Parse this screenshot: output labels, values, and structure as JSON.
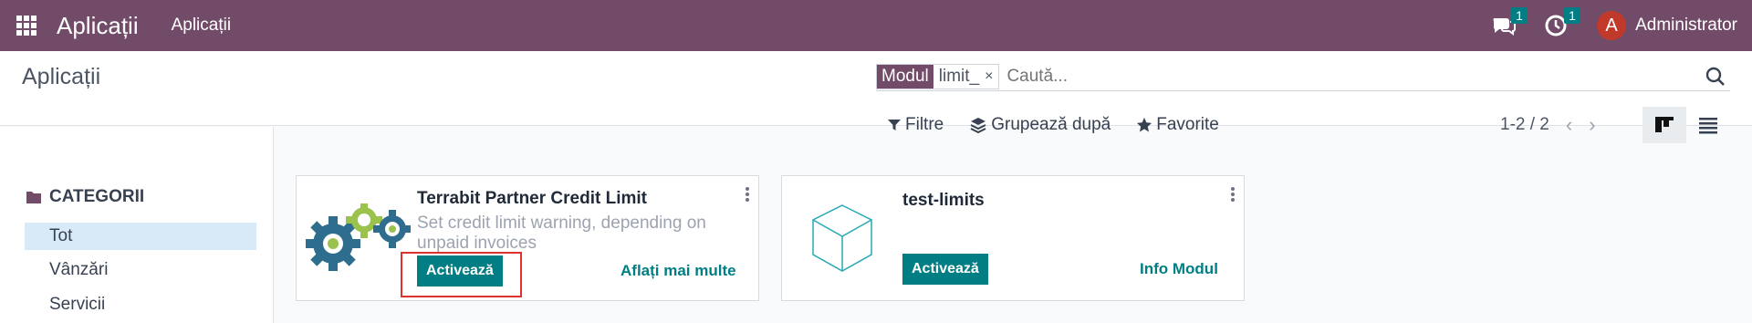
{
  "navbar": {
    "brand": "Aplicații",
    "menu": "Aplicații",
    "messages_count": "1",
    "activities_count": "1",
    "avatar_letter": "A",
    "user": "Administrator"
  },
  "control": {
    "title": "Aplicații",
    "facet_label": "Modul",
    "facet_value": "limit_",
    "facet_remove": "×",
    "search_placeholder": "Caută...",
    "filters_label": "Filtre",
    "group_by_label": "Grupează după",
    "favorites_label": "Favorite",
    "pager": "1-2 / 2"
  },
  "sidebar": {
    "header": "CATEGORII",
    "items": [
      {
        "label": "Tot",
        "active": true
      },
      {
        "label": "Vânzări",
        "active": false
      },
      {
        "label": "Servicii",
        "active": false
      }
    ]
  },
  "cards": [
    {
      "title": "Terrabit Partner Credit Limit",
      "description": "Set credit limit warning, depending on unpaid invoices",
      "primary_action": "Activează",
      "secondary_action": "Aflați mai multe",
      "icon": "gears-icon"
    },
    {
      "title": "test-limits",
      "description": "",
      "primary_action": "Activează",
      "secondary_action": "Info Modul",
      "icon": "cube-icon"
    }
  ],
  "colors": {
    "navbar": "#714b67",
    "accent": "#017e84",
    "highlight": "#e03131"
  }
}
